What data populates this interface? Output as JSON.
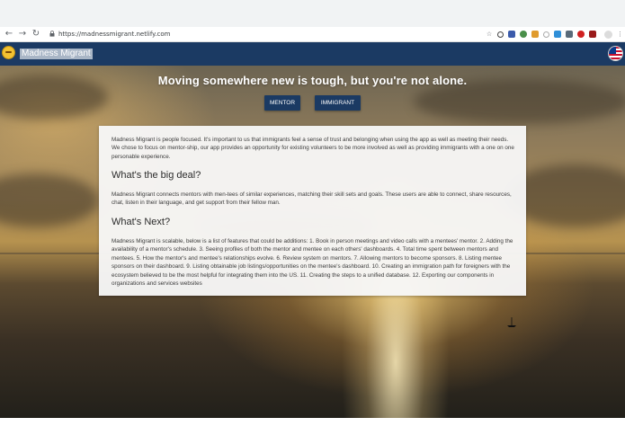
{
  "browser": {
    "url": "https://madnessmigrant.netlify.com",
    "back_glyph": "←",
    "forward_glyph": "→",
    "reload_glyph": "↻",
    "star_glyph": "☆",
    "menu_glyph": "⋮"
  },
  "navbar": {
    "brand": "Madness Migrant",
    "color": "#1b3a63"
  },
  "hero": {
    "headline": "Moving somewhere new is tough, but you're not alone.",
    "buttons": {
      "mentor": "MENTOR",
      "immigrant": "IMMIGRANT"
    }
  },
  "content": {
    "intro": "Madness Migrant is people focused. It's important to us that immigrants feel a sense of trust and belonging when using the app as well as meeting their needs. We chose to focus on mentor-ship, our app provides an opportunity for existing volunteers to be more involved as well as providing immigrants with a one on one personable experience.",
    "big_deal_heading": "What's the big deal?",
    "big_deal_text": "Madness Migrant connects mentors with men-tees of similar experiences, matching their skill sets and goals. These users are able to connect, share resources, chat, listen in their language, and get support from their fellow man.",
    "next_heading": "What's Next?",
    "next_text": "Madness Migrant is scalable, below is a list of features that could be additions: 1. Book in person meetings and video calls with a mentees' mentor. 2. Adding the availability of a mentor's schedule. 3. Seeing profiles of both the mentor and mentee on each others' dashboards. 4. Total time spent between mentors and mentees. 5. How the mentor's and mentee's relationships evolve. 6. Review system on mentors. 7. Allowing mentors to become sponsors. 8. Listing mentee sponsors on their dashboard. 9. Listing obtainable job listings/opportunities on the mentee's dashboard. 10. Creating an immigration path for foreigners with the ecosystem believed to be the most helpful for integrating them into the US. 11. Creating the steps to a unified database. 12. Exporting our components in organizations and services websites"
  }
}
